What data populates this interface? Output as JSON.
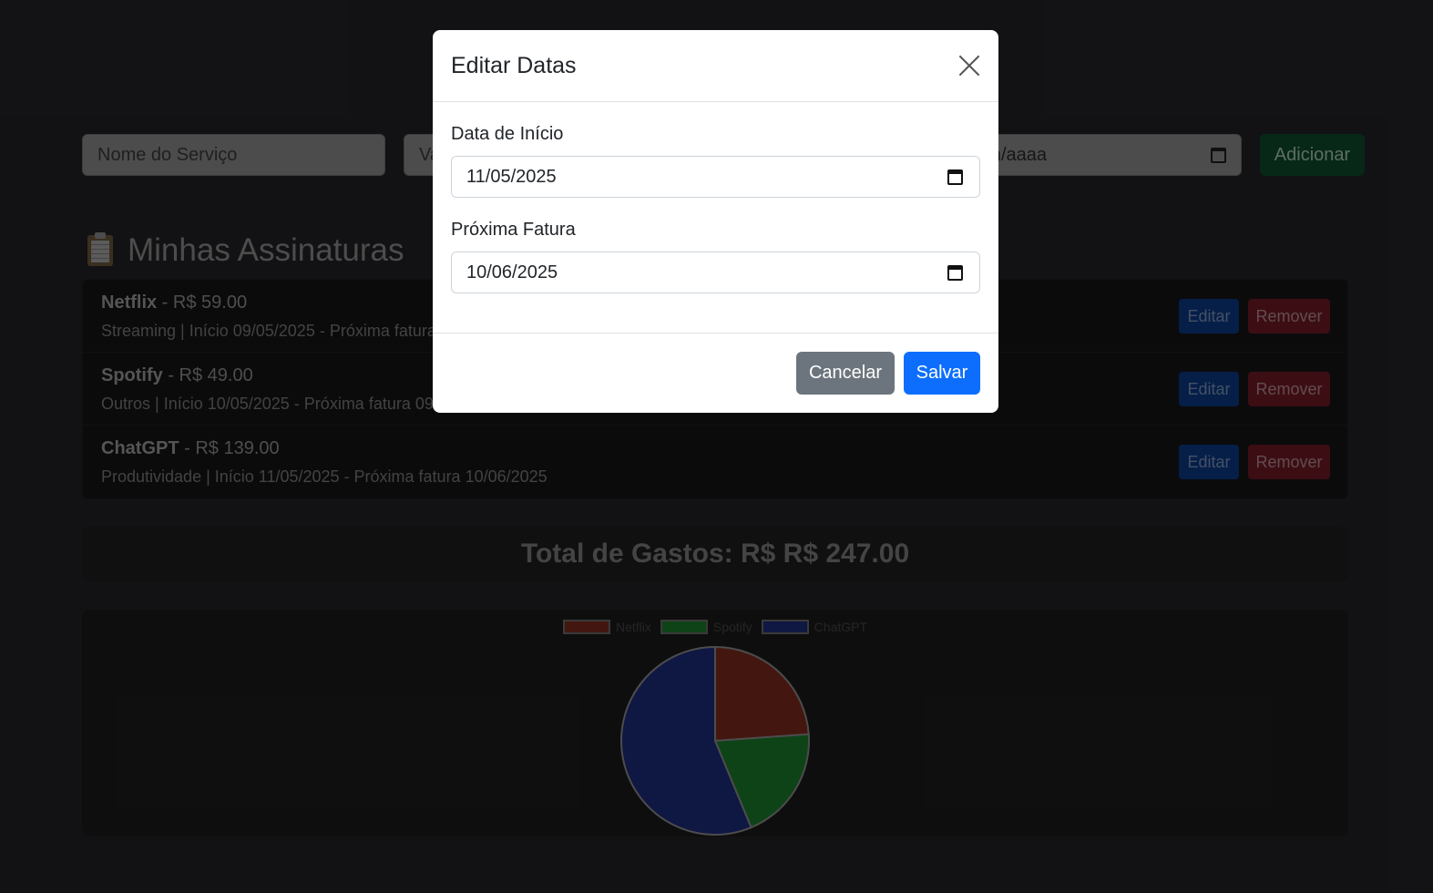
{
  "form": {
    "name_placeholder": "Nome do Serviço",
    "value_placeholder": "Va",
    "date_placeholder": "m/aaaa",
    "add_label": "Adicionar"
  },
  "section": {
    "title": "Minhas Assinaturas"
  },
  "subscriptions": [
    {
      "name": "Netflix",
      "price": " - R$ 59.00",
      "details": "Streaming | Início 09/05/2025 - Próxima fatura",
      "edit": "Editar",
      "remove": "Remover"
    },
    {
      "name": "Spotify",
      "price": " - R$ 49.00",
      "details": "Outros | Início 10/05/2025 - Próxima fatura 09",
      "edit": "Editar",
      "remove": "Remover"
    },
    {
      "name": "ChatGPT",
      "price": " - R$ 139.00",
      "details": "Produtividade | Início 11/05/2025 - Próxima fatura 10/06/2025",
      "edit": "Editar",
      "remove": "Remover"
    }
  ],
  "total": {
    "label": "Total de Gastos: R$ R$ 247.00"
  },
  "chart_data": {
    "type": "pie",
    "labels": [
      "Netflix",
      "Spotify",
      "ChatGPT"
    ],
    "values": [
      59,
      49,
      139
    ],
    "colors": [
      "#7a2a1c",
      "#1a7a2a",
      "#1c2a7a"
    ],
    "legend_position": "top"
  },
  "modal": {
    "title": "Editar Datas",
    "start_label": "Data de Início",
    "start_value": "11/05/2025",
    "next_label": "Próxima Fatura",
    "next_value": "10/06/2025",
    "cancel_label": "Cancelar",
    "save_label": "Salvar"
  }
}
